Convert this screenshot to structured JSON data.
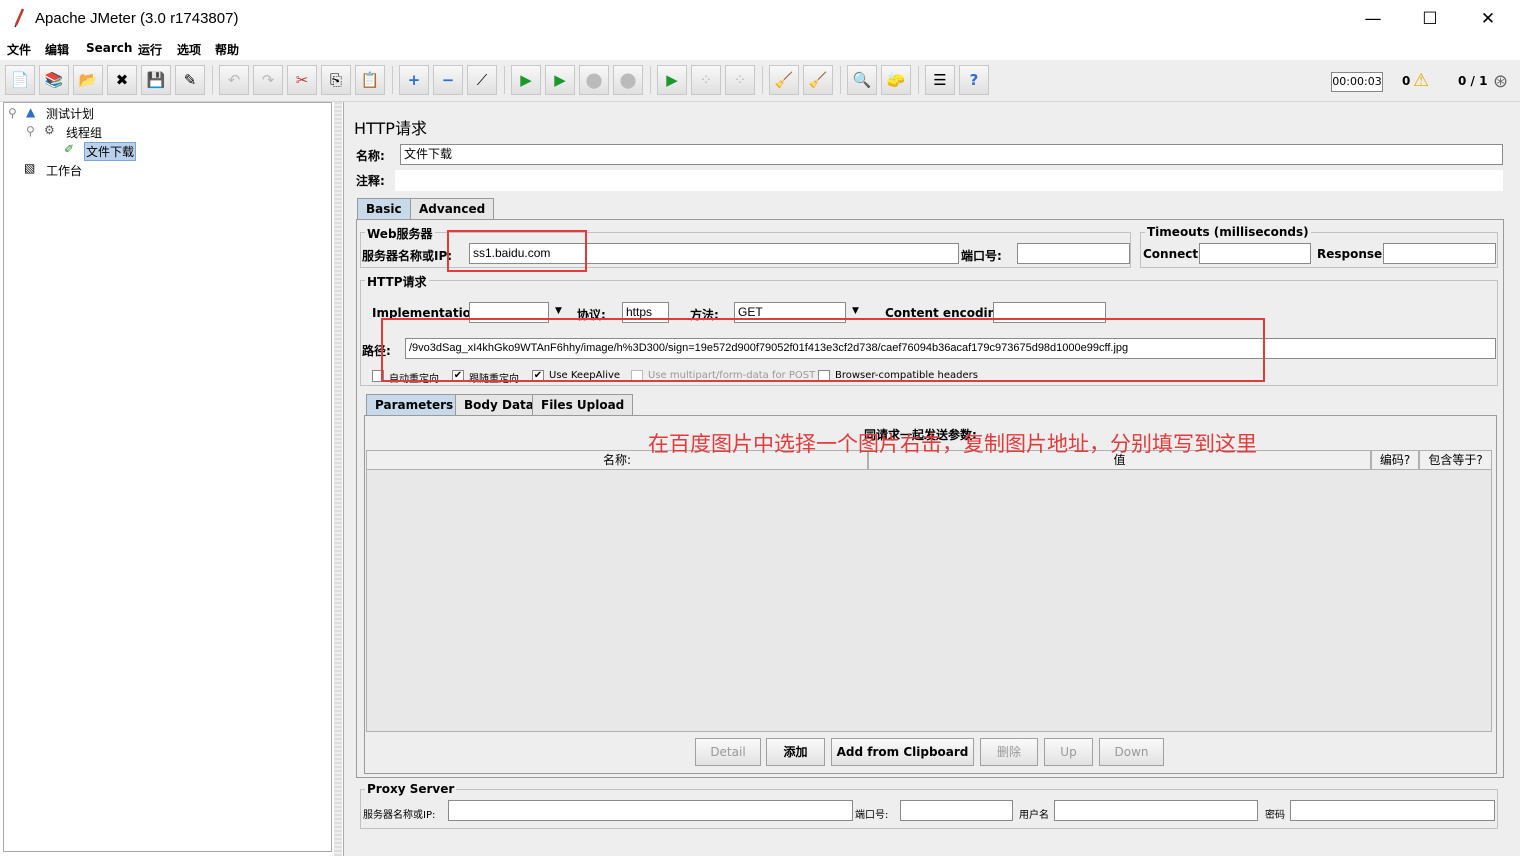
{
  "window": {
    "title": "Apache JMeter (3.0 r1743807)",
    "minimize": "—",
    "maximize": "☐",
    "close": "✕"
  },
  "menu": [
    "文件",
    "编辑",
    "Search",
    "运行",
    "选项",
    "帮助"
  ],
  "status": {
    "timer": "00:00:03",
    "warnings": "0",
    "threads": "0 / 1"
  },
  "tree": {
    "test_plan": "测试计划",
    "thread_group": "线程组",
    "sampler": "文件下载",
    "workbench": "工作台"
  },
  "panel": {
    "title": "HTTP请求",
    "name_label": "名称:",
    "name_value": "文件下载",
    "comment_label": "注释:",
    "tabs": [
      "Basic",
      "Advanced"
    ]
  },
  "web_server": {
    "group_title": "Web服务器",
    "host_label": "服务器名称或IP:",
    "host_value": "ss1.baidu.com",
    "port_label": "端口号:",
    "port_value": ""
  },
  "timeouts": {
    "group_title": "Timeouts (milliseconds)",
    "connect_label": "Connect:",
    "response_label": "Response:"
  },
  "http_request": {
    "group_title": "HTTP请求",
    "impl_label": "Implementation:",
    "impl_value": "",
    "protocol_label": "协议:",
    "protocol_value": "https",
    "method_label": "方法:",
    "method_value": "GET",
    "encoding_label": "Content encoding:",
    "path_label": "路径:",
    "path_value": "/9vo3dSag_xI4khGko9WTAnF6hhy/image/h%3D300/sign=19e572d900f79052f01f413e3cf2d738/caef76094b36acaf179c973675d98d1000e99cff.jpg"
  },
  "options": [
    {
      "label": "自动重定向",
      "checked": false,
      "enabled": true
    },
    {
      "label": "跟随重定向",
      "checked": true,
      "enabled": true
    },
    {
      "label": "Use KeepAlive",
      "checked": true,
      "enabled": true
    },
    {
      "label": "Use multipart/form-data for POST",
      "checked": false,
      "enabled": false
    },
    {
      "label": "Browser-compatible headers",
      "checked": false,
      "enabled": true
    }
  ],
  "param_tabs": [
    "Parameters",
    "Body Data",
    "Files Upload"
  ],
  "params_table": {
    "caption": "同请求一起发送参数:",
    "columns": [
      "名称:",
      "值",
      "编码?",
      "包含等于?"
    ],
    "rows": []
  },
  "buttons": {
    "detail": "Detail",
    "add": "添加",
    "clipboard": "Add from Clipboard",
    "delete": "删除",
    "up": "Up",
    "down": "Down"
  },
  "proxy": {
    "group_title": "Proxy Server",
    "host_label": "服务器名称或IP:",
    "port_label": "端口号:",
    "user_label": "用户名",
    "password_label": "密码"
  },
  "annotation": "在百度图片中选择一个图片右击，复制图片地址，分别填写到这里",
  "colors": {
    "annotation": "#e23b3b",
    "active_tab": "#c8daea",
    "selection": "#b9d1ea"
  }
}
